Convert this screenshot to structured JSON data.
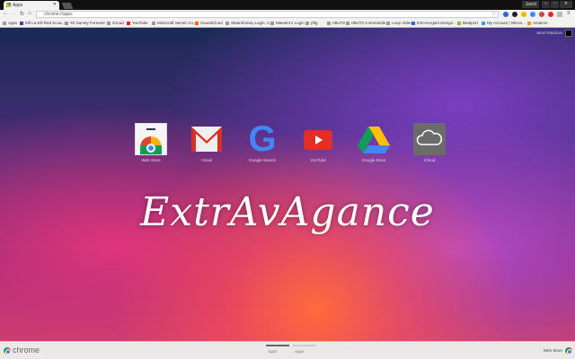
{
  "window": {
    "tab_title": "Apps",
    "user": "Jared"
  },
  "toolbar": {
    "url": "chrome://apps"
  },
  "bookmarks": [
    "Apps",
    "Kill La Kill Red Scoa...",
    "XII Survey Foreverr",
    "iCloud",
    "YouTube",
    "Minecraft Server Co...",
    "SoundCloud",
    "Steamhoney Login, C...",
    "Maestro's Login",
    "pftg",
    "nBUT2",
    "nBUT2 Commands",
    "Loop Video",
    "ExtrAvAgant Design...",
    "Beatport",
    "My Account | Wincs...",
    "Amazon"
  ],
  "main": {
    "user_name": "Jared Madison",
    "logo_text": "ExtrAvAgance",
    "apps": [
      {
        "label": "Web Store"
      },
      {
        "label": "Gmail"
      },
      {
        "label": "Google Search"
      },
      {
        "label": "YouTube"
      },
      {
        "label": "Google Drive"
      },
      {
        "label": "iCloud"
      }
    ]
  },
  "bottom": {
    "brand": "chrome",
    "pages": [
      "Apps",
      "Apps"
    ],
    "webstore": "Web Store"
  }
}
